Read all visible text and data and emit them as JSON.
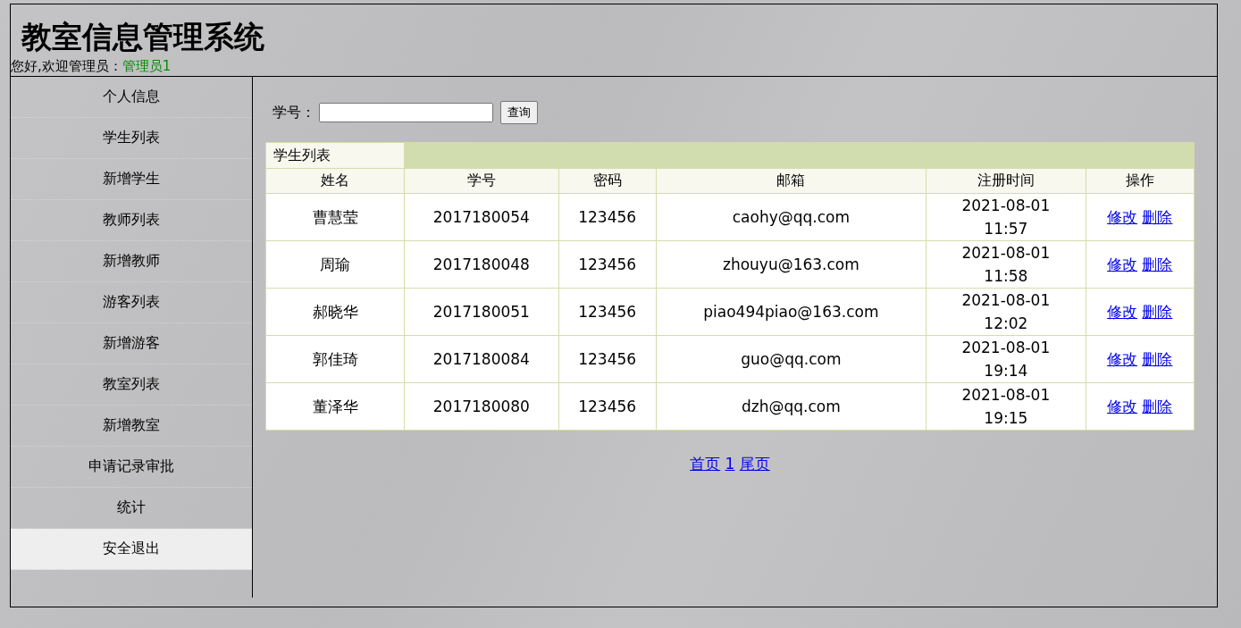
{
  "header": {
    "title": "教室信息管理系统",
    "greeting": "您好,欢迎管理员：",
    "user": "管理员1"
  },
  "sidebar": {
    "items": [
      {
        "label": "个人信息",
        "selected": false
      },
      {
        "label": "学生列表",
        "selected": false
      },
      {
        "label": "新增学生",
        "selected": false
      },
      {
        "label": "教师列表",
        "selected": false
      },
      {
        "label": "新增教师",
        "selected": false
      },
      {
        "label": "游客列表",
        "selected": false
      },
      {
        "label": "新增游客",
        "selected": false
      },
      {
        "label": "教室列表",
        "selected": false
      },
      {
        "label": "新增教室",
        "selected": false
      },
      {
        "label": "申请记录审批",
        "selected": false
      },
      {
        "label": "统计",
        "selected": false
      },
      {
        "label": "安全退出",
        "selected": true
      }
    ]
  },
  "search": {
    "label": "学号：",
    "button": "查询"
  },
  "table": {
    "caption": "学生列表",
    "columns": [
      "姓名",
      "学号",
      "密码",
      "邮箱",
      "注册时间",
      "操作"
    ],
    "rows": [
      {
        "name": "曹慧莹",
        "id": "2017180054",
        "password": "123456",
        "email": "caohy@qq.com",
        "time": "2021-08-01 11:57",
        "actions": [
          "修改",
          "删除"
        ]
      },
      {
        "name": "周瑜",
        "id": "2017180048",
        "password": "123456",
        "email": "zhouyu@163.com",
        "time": "2021-08-01 11:58",
        "actions": [
          "修改",
          "删除"
        ]
      },
      {
        "name": "郝晓华",
        "id": "2017180051",
        "password": "123456",
        "email": "piao494piao@163.com",
        "time": "2021-08-01 12:02",
        "actions": [
          "修改",
          "删除"
        ]
      },
      {
        "name": "郭佳琦",
        "id": "2017180084",
        "password": "123456",
        "email": "guo@qq.com",
        "time": "2021-08-01 19:14",
        "actions": [
          "修改",
          "删除"
        ]
      },
      {
        "name": "董泽华",
        "id": "2017180080",
        "password": "123456",
        "email": "dzh@qq.com",
        "time": "2021-08-01 19:15",
        "actions": [
          "修改",
          "删除"
        ]
      }
    ]
  },
  "pagination": [
    "首页",
    "1",
    "尾页"
  ]
}
